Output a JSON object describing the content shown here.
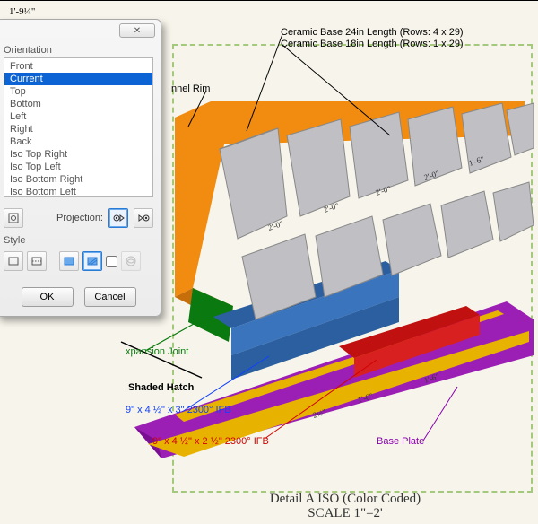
{
  "top_dimension": "1'-9¼\"",
  "dialog": {
    "close_glyph": "✕",
    "orientation_label": "Orientation",
    "orientations": [
      "Front",
      "Current",
      "Top",
      "Bottom",
      "Left",
      "Right",
      "Back",
      "Iso Top Right",
      "Iso Top Left",
      "Iso Bottom Right",
      "Iso Bottom Left"
    ],
    "selected_index": 1,
    "projection_label": "Projection:",
    "style_label": "Style",
    "ok_label": "OK",
    "cancel_label": "Cancel"
  },
  "annotations": {
    "ceramic24": "Ceramic Base 24in Length (Rows: 4 x 29)",
    "ceramic18": "Ceramic Base 18in Length (Rows: 1 x 29)",
    "channel_rim": "nnel Rim",
    "expansion_joint": "xpansion Joint",
    "shaded_hatch": "Shaded Hatch",
    "blue_ifb": "9\" x 4 ½\" x 3\" 2300° IFB",
    "red_ifb": "9\" x 4 ½\" x 2 ½\" 2300° IFB",
    "base_plate": "Base Plate"
  },
  "dimensions_iso": [
    "2'-0\"",
    "2'-0\"",
    "2'-0\"",
    "2'-0\"",
    "1'-6\""
  ],
  "bottom_dims": [
    "2½\"",
    "1'-6\"",
    "1'-6\""
  ],
  "title": "Detail A ISO (Color Coded)",
  "scale": "SCALE 1\"=2'"
}
